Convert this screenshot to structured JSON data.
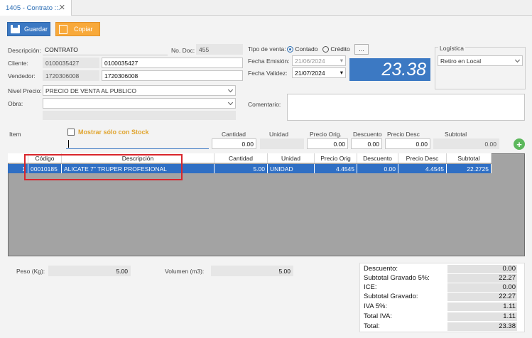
{
  "tab": {
    "title": "1405 - Contrato ::.",
    "close": "✕"
  },
  "toolbar": {
    "save_label": "Guardar",
    "copy_label": "Copiar"
  },
  "form": {
    "descripcion_label": "Descripción:",
    "descripcion_value": "CONTRATO",
    "nodoc_label": "No. Doc:",
    "nodoc_value": "455",
    "cliente_label": "Cliente:",
    "cliente_code": "0100035427",
    "cliente_value": "0100035427",
    "vendedor_label": "Vendedor:",
    "vendedor_code": "1720306008",
    "vendedor_value": "1720306008",
    "nivel_label": "Nivel Precio:",
    "nivel_value": "PRECIO DE VENTA AL PUBLICO",
    "obra_label": "Obra:",
    "obra_value": "",
    "tipo_venta_label": "Tipo de venta:",
    "contado_label": "Contado",
    "credito_label": "Crédito",
    "more_label": "...",
    "fecha_emision_label": "Fecha Emisión:",
    "fecha_emision_value": "21/06/2024",
    "fecha_validez_label": "Fecha Validez:",
    "fecha_validez_value": "21/07/2024",
    "comentario_label": "Comentario:",
    "comentario_value": "",
    "total_value": "23.38",
    "logistica_label": "Logística",
    "logistica_value": "Retiro en Local"
  },
  "entry": {
    "item_label": "Item",
    "stock_label": "Mostrar sólo con Stock",
    "cantidad_label": "Cantidad",
    "unidad_label": "Unidad",
    "precio_orig_label": "Precio Orig.",
    "descuento_label": "Descuento",
    "precio_desc_label": "Precio Desc",
    "subtotal_label": "Subtotal",
    "cantidad_value": "0.00",
    "precio_orig_value": "0.00",
    "descuento_value": "0.00",
    "precio_desc_value": "0.00",
    "subtotal_value": "0.00"
  },
  "grid": {
    "headers": [
      "",
      "Código",
      "Descripción",
      "Cantidad",
      "Unidad",
      "Precio Orig",
      "Descuento",
      "Precio Desc",
      "Subtotal"
    ],
    "rows": [
      {
        "n": "1",
        "codigo": "00010185",
        "descripcion": "ALICATE 7\" TRUPER PROFESIONAL",
        "cantidad": "5.00",
        "unidad": "UNIDAD",
        "precio_orig": "4.4545",
        "descuento": "0.00",
        "precio_desc": "4.4545",
        "subtotal": "22.2725"
      }
    ]
  },
  "footer": {
    "peso_label": "Peso (Kg):",
    "peso_value": "5.00",
    "volumen_label": "Volumen (m3):",
    "volumen_value": "5.00"
  },
  "summary": [
    {
      "label": "Descuento:",
      "value": "0.00"
    },
    {
      "label": "Subtotal Gravado 5%:",
      "value": "22.27"
    },
    {
      "label": "ICE:",
      "value": "0.00"
    },
    {
      "label": "Subtotal Gravado:",
      "value": "22.27"
    },
    {
      "label": "IVA 5%:",
      "value": "1.11"
    },
    {
      "label": "Total IVA:",
      "value": "1.11"
    },
    {
      "label": "Total:",
      "value": "23.38"
    }
  ],
  "colors": {
    "accent": "#3c79c3",
    "copy": "#f8a93a",
    "selected_row": "#2f6fc4",
    "highlight_box": "#d9262c",
    "add_button": "#5cb85c",
    "stock_label": "#e0a530"
  }
}
